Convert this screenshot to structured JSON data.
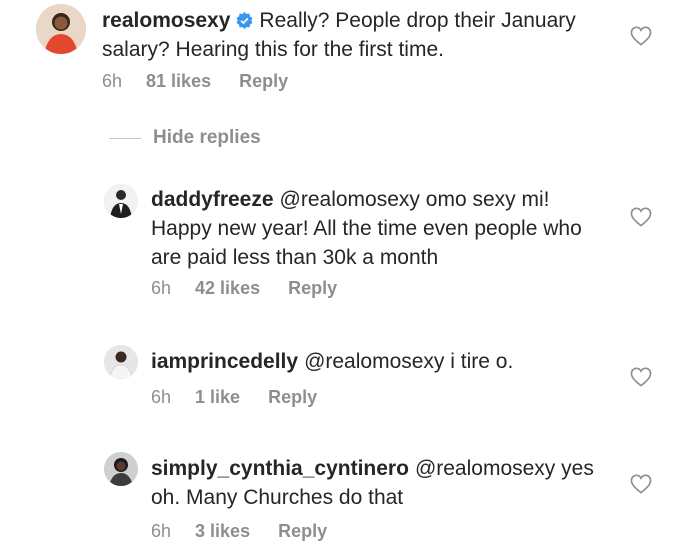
{
  "comments": [
    {
      "username": "realomosexy",
      "verified": true,
      "mention": "",
      "text": "Really? People drop their January salary? Hearing this for the first time.",
      "time": "6h",
      "likes": "81 likes",
      "reply": "Reply"
    },
    {
      "username": "daddyfreeze",
      "mention": "@realomosexy",
      "text": "omo sexy mi! Happy new year! All the time even people who are paid less than 30k a month",
      "time": "6h",
      "likes": "42 likes",
      "reply": "Reply"
    },
    {
      "username": "iamprincedelly",
      "mention": "@realomosexy",
      "text": "i tire o.",
      "time": "6h",
      "likes": "1 like",
      "reply": "Reply"
    },
    {
      "username": "simply_cynthia_cyntinero",
      "mention": "@realomosexy",
      "text": "yes oh. Many Churches do that",
      "time": "6h",
      "likes": "3 likes",
      "reply": "Reply"
    }
  ],
  "hide_replies": "Hide replies",
  "colors": {
    "text": "#262626",
    "meta": "#8e8e8e",
    "verified_badge": "#3897f0"
  }
}
